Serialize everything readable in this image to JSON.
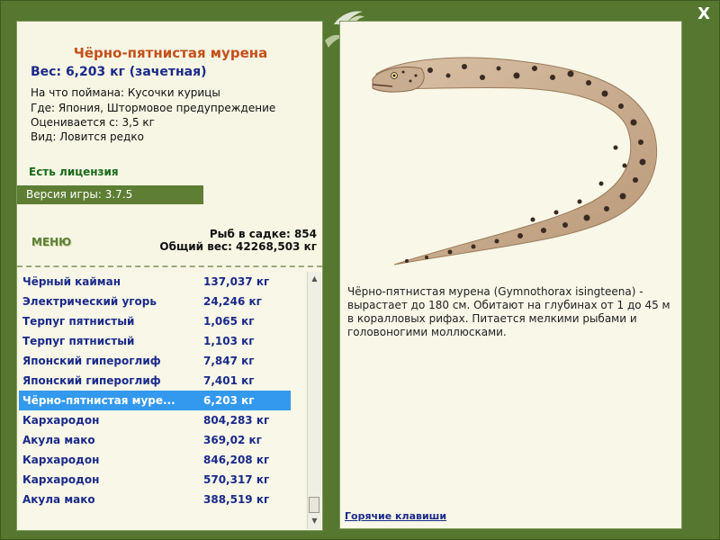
{
  "window": {
    "close_label": "X"
  },
  "fish": {
    "title": "Чёрно-пятнистая мурена",
    "weight": "Вес: 6,203 кг (зачетная)",
    "bait": "На что поймана: Кусочки курицы",
    "place": "Где: Япония, Штормовое предупреждение",
    "rated": "Оценивается с: 3,5 кг",
    "kind": "Вид: Ловится редко",
    "description": "Чёрно-пятнистая мурена (Gymnothorax isingteena) - вырастает до 180 см. Обитают на глубинах от 1 до 45 м в коралловых рифах. Питается мелкими рыбами и головоногими моллюсками."
  },
  "license": "Есть лицензия",
  "version": "Версия игры: 3.7.5",
  "menu_label": "МЕНЮ",
  "stats": {
    "count": "Рыб в садке: 854",
    "total": "Общий вес: 42268,503 кг"
  },
  "catch_list": [
    {
      "name": "Чёрный кайман",
      "weight": "137,037 кг"
    },
    {
      "name": "Электрический угорь",
      "weight": "24,246 кг"
    },
    {
      "name": "Терпуг пятнистый",
      "weight": "1,065 кг"
    },
    {
      "name": "Терпуг пятнистый",
      "weight": "1,103 кг"
    },
    {
      "name": "Японский гипероглиф",
      "weight": "7,847 кг"
    },
    {
      "name": "Японский гипероглиф",
      "weight": "7,401 кг"
    },
    {
      "name": "Чёрно-пятнистая муре...",
      "weight": "6,203 кг",
      "selected": true
    },
    {
      "name": "Кархародон",
      "weight": "804,283 кг"
    },
    {
      "name": "Акула мако",
      "weight": "369,02 кг"
    },
    {
      "name": "Кархародон",
      "weight": "846,208 кг"
    },
    {
      "name": "Кархародон",
      "weight": "570,317 кг"
    },
    {
      "name": "Акула мако",
      "weight": "388,519 кг"
    }
  ],
  "hotkeys_label": "Горячие клавиши",
  "colors": {
    "frame": "#55772f",
    "panel": "#f8f7e8",
    "title": "#c4501a",
    "list_text": "#1a2a8a",
    "selection": "#3399ee"
  }
}
